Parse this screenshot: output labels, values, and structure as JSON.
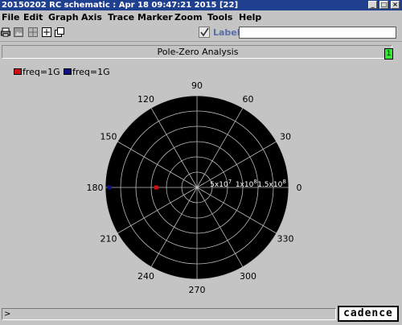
{
  "window": {
    "title": "20150202 RC schematic : Apr 18 09:47:21 2015 [22]"
  },
  "menu": {
    "items": [
      "File",
      "Edit",
      "Graph",
      "Axis",
      "Trace",
      "Marker",
      "Zoom",
      "Tools",
      "Help"
    ]
  },
  "toolbar": {
    "icons": [
      "printer-icon",
      "image-icon",
      "grid-icon",
      "zoom-fit-icon",
      "new-window-icon"
    ],
    "label_text": "Label",
    "label_checked": true,
    "label_value": ""
  },
  "graph": {
    "title": "Pole-Zero Analysis",
    "number": "1"
  },
  "legend": [
    {
      "label": "freq=1G",
      "color": "#d01010"
    },
    {
      "label": "freq=1G",
      "color": "#101080"
    }
  ],
  "chart_data": {
    "type": "scatter",
    "polar": true,
    "title": "Pole-Zero Analysis",
    "angle_ticks": [
      "90",
      "60",
      "30",
      "0",
      "330",
      "300",
      "270",
      "240",
      "210",
      "180",
      "150",
      "120"
    ],
    "radial_ticks": [
      "5x10",
      "1x10",
      "1.5x10"
    ],
    "radial_tick_exponents": [
      "7",
      "8",
      "8"
    ],
    "radial_tick_values": [
      50000000,
      100000000,
      150000000
    ],
    "r_max": 180000000,
    "background": "#000000",
    "grid_color": "#bbbbbb",
    "series": [
      {
        "name": "freq=1G",
        "color": "#d01010",
        "points": [
          {
            "angle_deg": 180,
            "r": 80000000
          }
        ]
      },
      {
        "name": "freq=1G",
        "color": "#101080",
        "points": [
          {
            "angle_deg": 180,
            "r": 172000000
          }
        ]
      }
    ]
  },
  "status": {
    "prompt": ">",
    "logo": "cadence"
  }
}
